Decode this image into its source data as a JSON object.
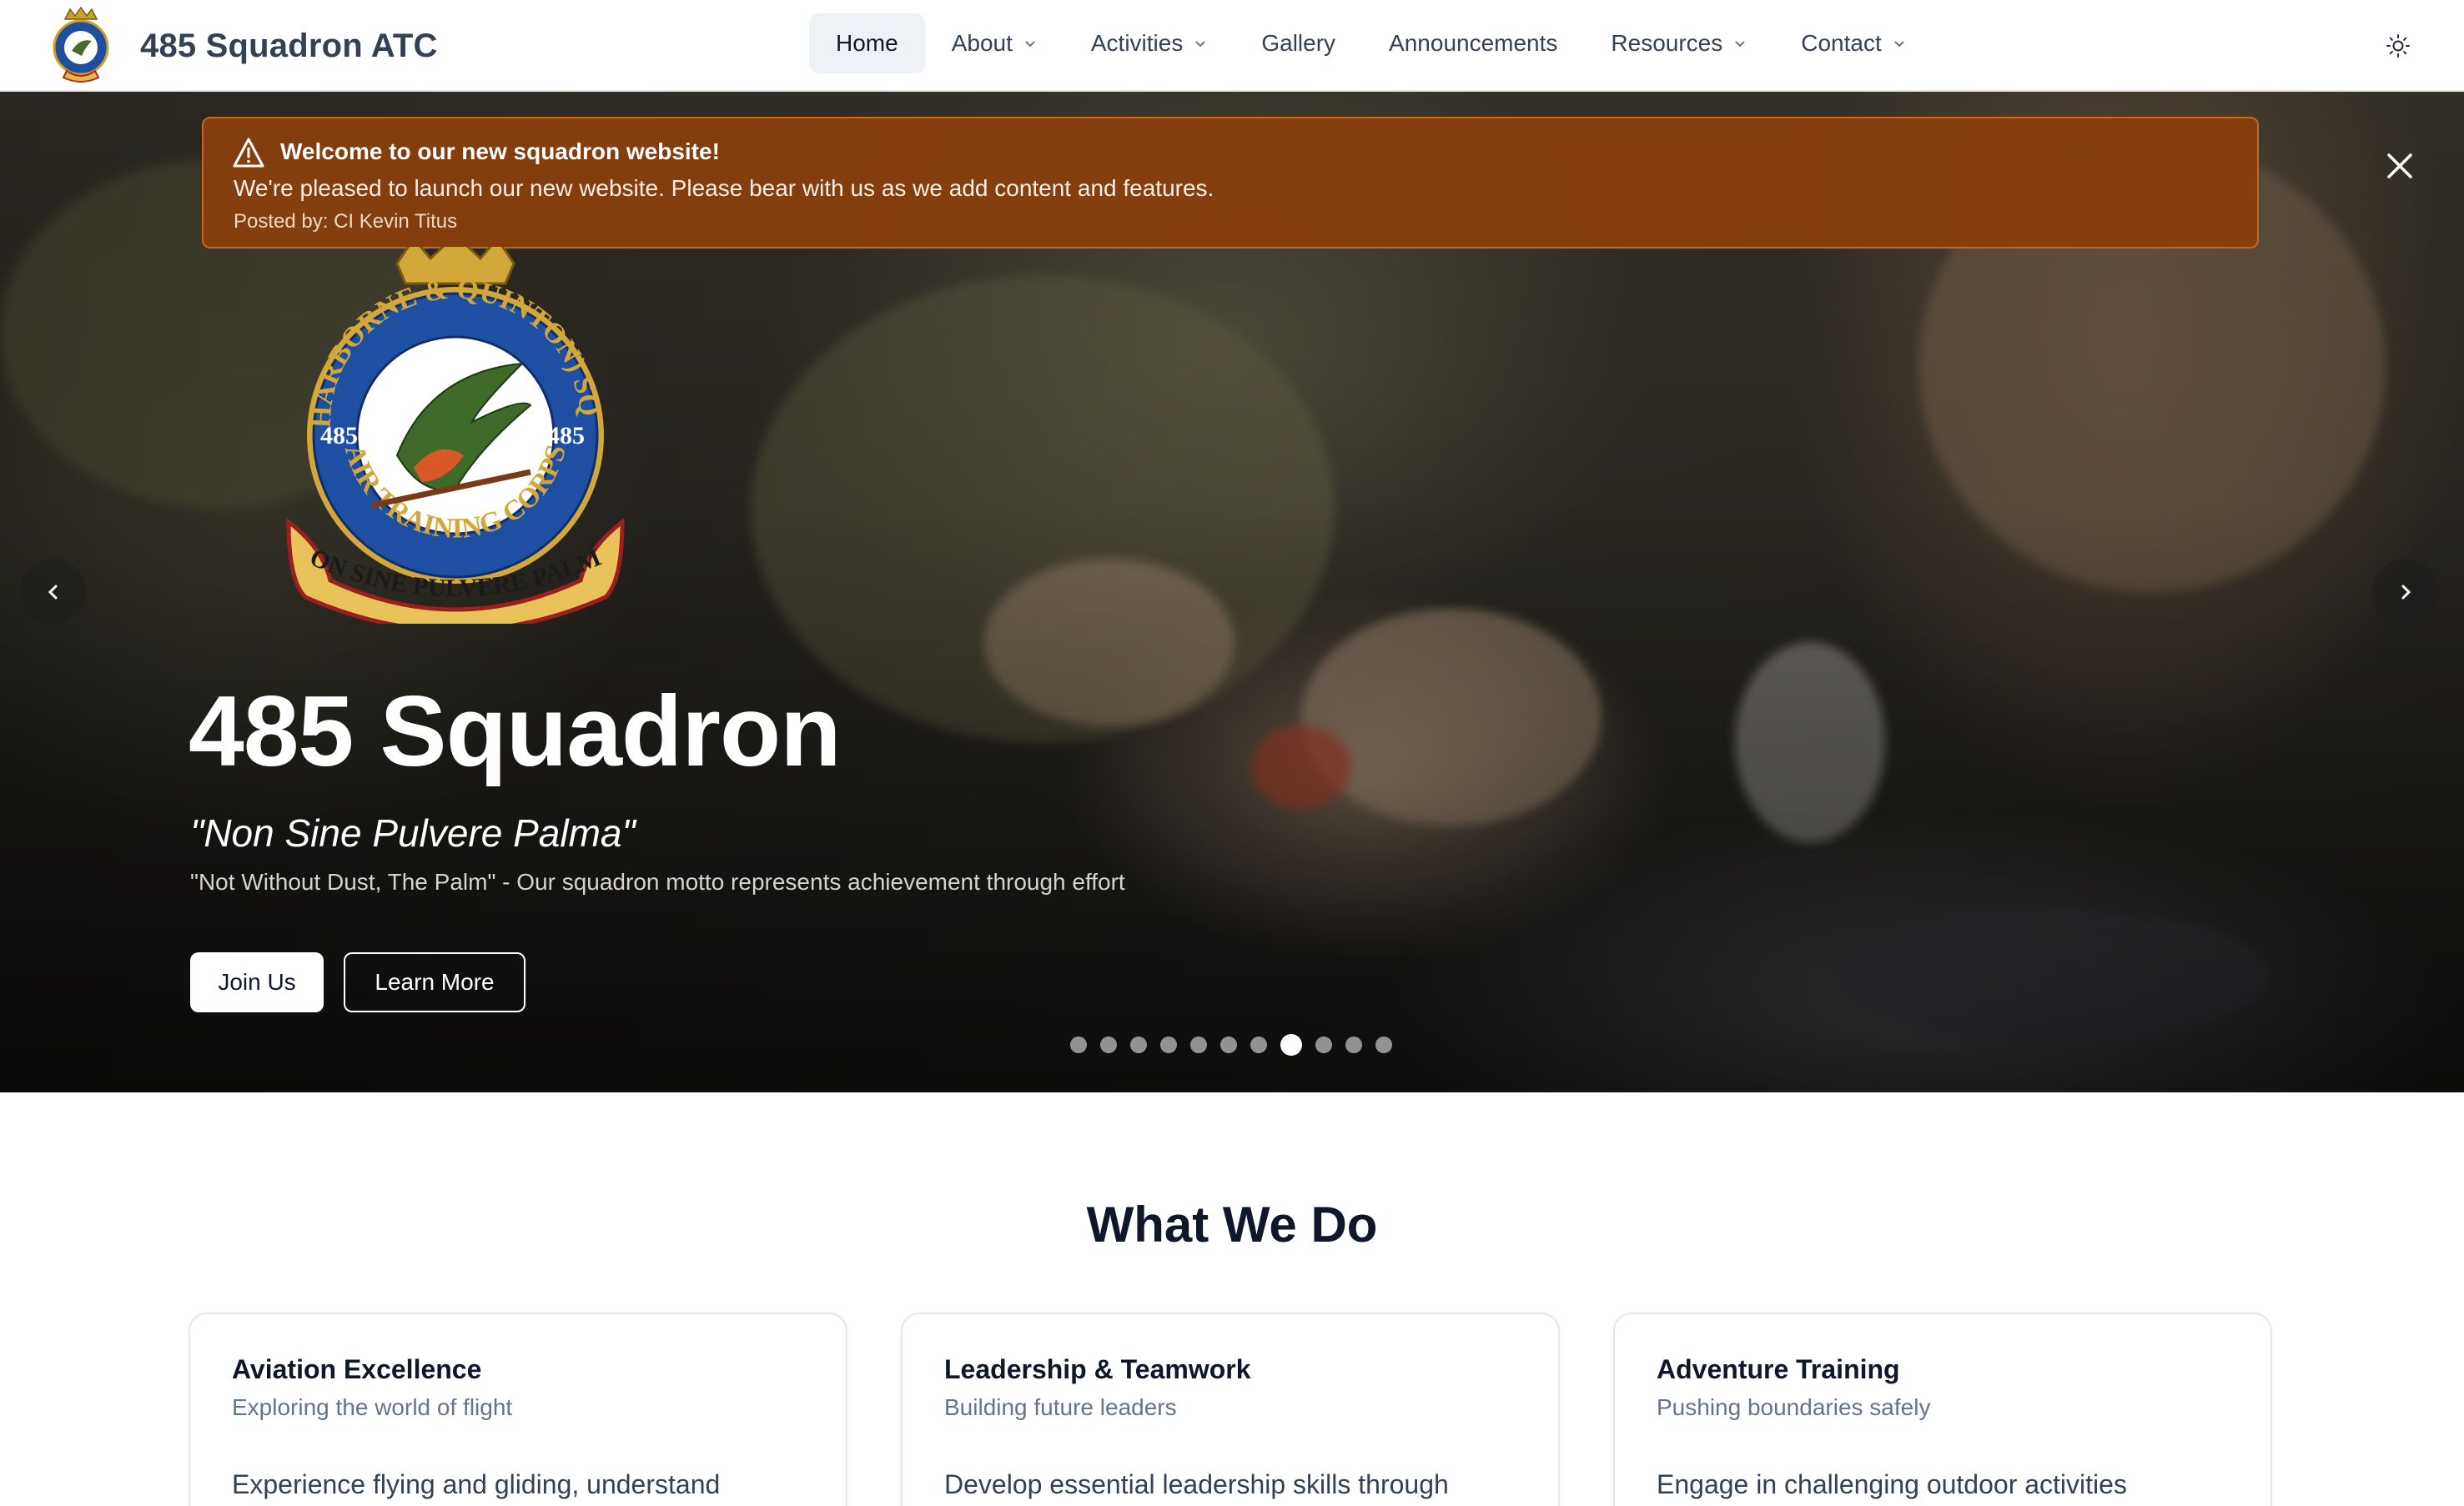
{
  "brand": {
    "name": "485 Squadron ATC"
  },
  "nav": {
    "items": [
      {
        "label": "Home",
        "active": true,
        "dropdown": false
      },
      {
        "label": "About",
        "active": false,
        "dropdown": true
      },
      {
        "label": "Activities",
        "active": false,
        "dropdown": true
      },
      {
        "label": "Gallery",
        "active": false,
        "dropdown": false
      },
      {
        "label": "Announcements",
        "active": false,
        "dropdown": false
      },
      {
        "label": "Resources",
        "active": false,
        "dropdown": true
      },
      {
        "label": "Contact",
        "active": false,
        "dropdown": true
      }
    ],
    "theme_toggle_icon": "sun-icon"
  },
  "alert": {
    "title": "Welcome to our new squadron website!",
    "message": "We're pleased to launch our new website. Please bear with us as we add content and features.",
    "meta": "Posted by: CI Kevin Titus",
    "color": "#8a3f0c"
  },
  "crest": {
    "ring_text": "(HARBORNE & QUINTON) SQN",
    "lower_ring_text": "AIR TRAINING CORPS",
    "number": "485",
    "scroll_text": "NON SINE PULVERE PALMA"
  },
  "hero": {
    "title": "485 Squadron",
    "motto": "\"Non Sine Pulvere Palma\"",
    "subtitle": "\"Not Without Dust, The Palm\" - Our squadron motto represents achievement through effort",
    "primary_button": "Join Us",
    "secondary_button": "Learn More",
    "slide_count": 11,
    "active_slide": 8
  },
  "what_we_do": {
    "title": "What We Do",
    "cards": [
      {
        "title": "Aviation Excellence",
        "subtitle": "Exploring the world of flight",
        "body": "Experience flying and gliding, understand"
      },
      {
        "title": "Leadership & Teamwork",
        "subtitle": "Building future leaders",
        "body": "Develop essential leadership skills through"
      },
      {
        "title": "Adventure Training",
        "subtitle": "Pushing boundaries safely",
        "body": "Engage in challenging outdoor activities"
      }
    ]
  }
}
